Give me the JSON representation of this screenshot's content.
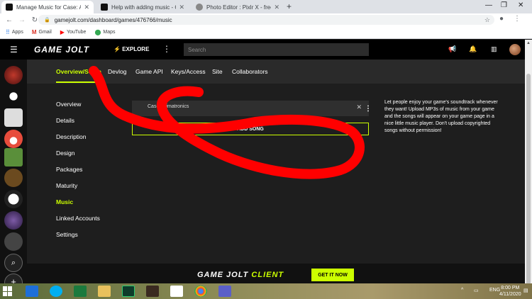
{
  "browser": {
    "tabs": [
      {
        "title": "Manage Music for Case: Animatronics",
        "active": true
      },
      {
        "title": "Help with adding music - Game Jolt",
        "active": false
      },
      {
        "title": "Photo Editor : Pixlr X - free image",
        "active": false
      }
    ],
    "url": "gamejolt.com/dashboard/games/476766/music",
    "bookmarks": [
      {
        "label": "Apps",
        "icon": "apps-grid-icon"
      },
      {
        "label": "Gmail",
        "icon": "gmail-icon"
      },
      {
        "label": "YouTube",
        "icon": "youtube-icon"
      },
      {
        "label": "Maps",
        "icon": "maps-pin-icon"
      }
    ]
  },
  "header": {
    "logo": "GAME JOLT",
    "explore": "EXPLORE",
    "search_placeholder": "Search"
  },
  "subnav": {
    "items": [
      "Overview/Setup",
      "Devlog",
      "Game API",
      "Keys/Access",
      "Site",
      "Collaborators"
    ],
    "active": "Overview/Setup"
  },
  "side_menu": {
    "items": [
      "Overview",
      "Details",
      "Description",
      "Design",
      "Packages",
      "Maturity",
      "Music",
      "Linked Accounts",
      "Settings"
    ],
    "active": "Music"
  },
  "music": {
    "song_title": "Case Animatronics",
    "add_song_label": "ADD SONG",
    "help_text": "Let people enjoy your game's soundtrack whenever they want! Upload MP3s of music from your game and the songs will appear on your game page in a nice little music player. Don't upload copyrighted songs without permission!"
  },
  "footer": {
    "client_logo_a": "GAME JOLT ",
    "client_logo_b": "CLIENT",
    "get_it": "GET IT NOW"
  },
  "taskbar": {
    "language": "ENG",
    "time": "8:00 PM",
    "date": "4/11/2020"
  },
  "colors": {
    "accent": "#ccff00",
    "scribble": "#ff0000"
  }
}
